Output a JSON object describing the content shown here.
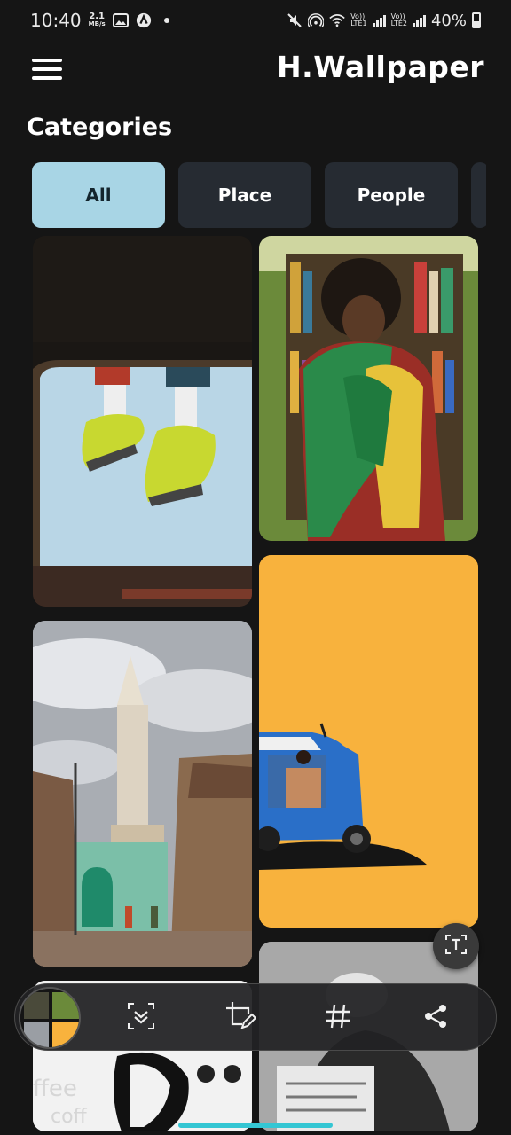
{
  "status_bar": {
    "time": "10:40",
    "net_speed_value": "2.1",
    "net_speed_unit": "MB/s",
    "lte1": "LTE1",
    "lte2": "LTE2",
    "vo1": "Vo))",
    "vo2": "Vo))",
    "battery": "40%"
  },
  "header": {
    "app_title": "H.Wallpaper",
    "section_title": "Categories"
  },
  "categories": [
    {
      "label": "All",
      "active": true
    },
    {
      "label": "Place",
      "active": false
    },
    {
      "label": "People",
      "active": false
    }
  ],
  "colors": {
    "background": "#151515",
    "chip_active": "#a8d5e5",
    "chip_inactive": "#262b32",
    "home_indicator": "#34c6d3"
  },
  "icons": {
    "menu": "menu-icon",
    "scan_text": "scan-text-icon",
    "scroll_capture": "scroll-capture-icon",
    "edit": "crop-edit-icon",
    "tag": "hashtag-icon",
    "share": "share-icon"
  }
}
